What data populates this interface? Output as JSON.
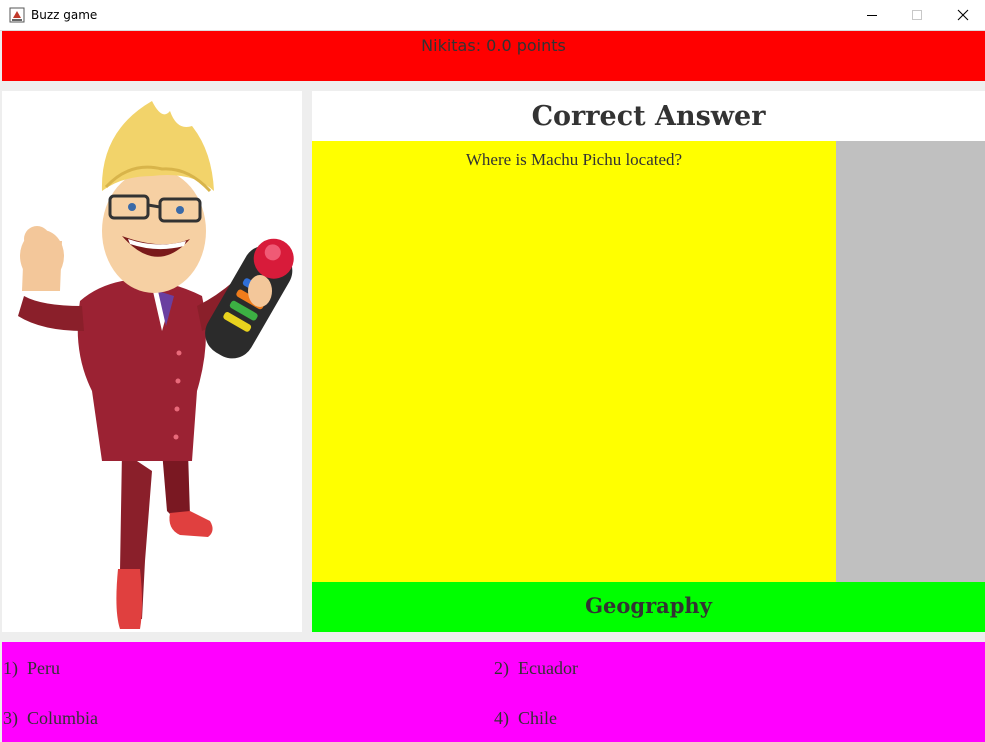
{
  "window": {
    "title": "Buzz game",
    "icon": "java-app-icon",
    "controls": [
      "minimize-icon",
      "maximize-icon",
      "close-icon"
    ]
  },
  "score": {
    "text": "Nikitas: 0.0 points",
    "background": "#ff0000"
  },
  "status": {
    "text": "Correct Answer"
  },
  "question": {
    "text": "Where is Machu Pichu located?",
    "background": "#ffff00"
  },
  "category": {
    "text": "Geography",
    "background": "#00ff00"
  },
  "answers": {
    "background": "#ff00ff",
    "items": [
      {
        "label": "1)  Peru"
      },
      {
        "label": "2)  Ecuador"
      },
      {
        "label": "3)  Columbia"
      },
      {
        "label": "4)  Chile"
      }
    ]
  },
  "host_image": {
    "icon": "buzz-host-image"
  }
}
